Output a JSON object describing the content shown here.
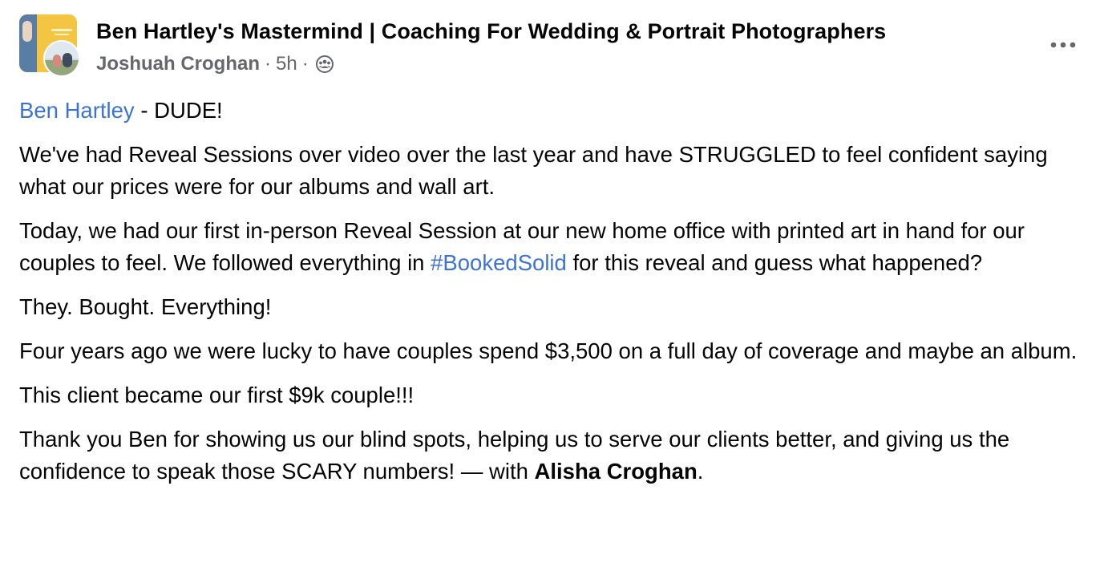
{
  "post": {
    "group_name": "Ben Hartley's Mastermind | Coaching For Wedding & Portrait Photographers",
    "author": "Joshuah Croghan",
    "separator": "·",
    "time": "5h",
    "audience_icon": "group-audience-icon",
    "more_icon": "more-options-icon",
    "content": {
      "mention": "Ben Hartley",
      "mention_suffix": " - DUDE!",
      "p2": "We've had Reveal Sessions over video over the last year and have STRUGGLED to feel confident saying what our prices were for our albums and wall art.",
      "p3_before": "Today, we had our first in-person Reveal Session at our new home office with printed art in hand for our couples to feel. We followed everything in ",
      "p3_hashtag": "#BookedSolid",
      "p3_after": " for this reveal and guess what happened?",
      "p4": "They. Bought. Everything!",
      "p5": "Four years ago we were lucky to have couples spend $3,500 on a full day of coverage and maybe an album.",
      "p6": "This client became our first $9k couple!!!",
      "p7_before": "Thank you Ben for showing us our blind spots, helping us to serve our clients better, and giving us the confidence to speak those SCARY numbers! — with ",
      "p7_tagged": "Alisha Croghan",
      "p7_after": "."
    }
  },
  "colors": {
    "text": "#050505",
    "secondary": "#65676b",
    "link": "#3b73d6"
  }
}
